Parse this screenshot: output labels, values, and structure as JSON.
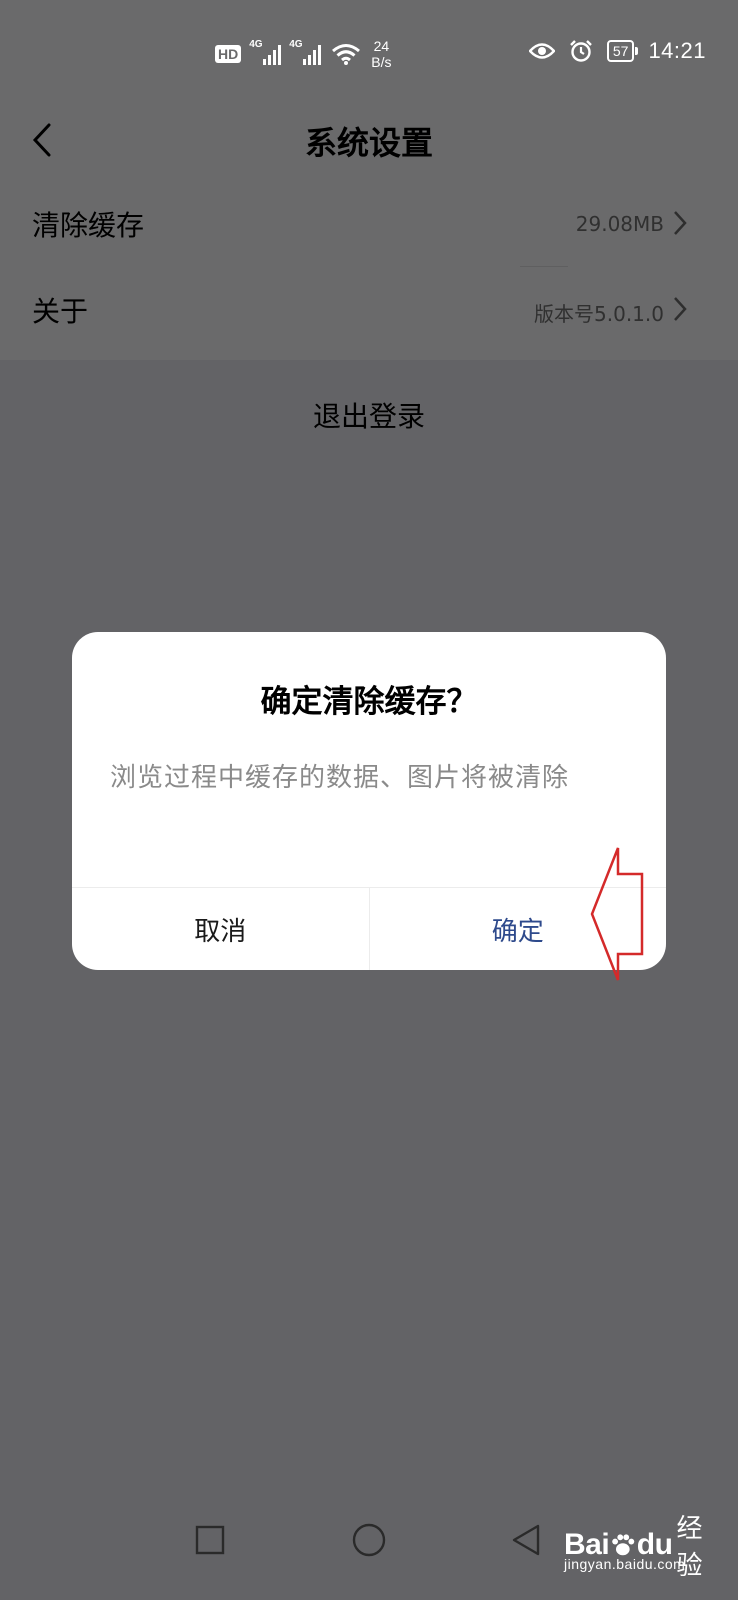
{
  "status_bar": {
    "hd_label": "HD",
    "network_1": "4G",
    "network_2": "4G",
    "net_speed_value": "24",
    "net_speed_unit": "B/s",
    "battery": "57",
    "time": "14:21"
  },
  "header": {
    "title": "系统设置"
  },
  "settings": {
    "items": [
      {
        "label": "清除缓存",
        "value": "29.08MB"
      },
      {
        "label": "关于",
        "value": "版本号5.0.1.0"
      }
    ],
    "logout_label": "退出登录"
  },
  "dialog": {
    "title": "确定清除缓存？",
    "message": "浏览过程中缓存的数据、图片将被清除",
    "cancel_label": "取消",
    "confirm_label": "确定"
  },
  "watermark": {
    "logo_left": "Bai",
    "logo_right": "du",
    "logo_cn": "经验",
    "url": "jingyan.baidu.com"
  },
  "colors": {
    "overlay_bg": "#636366",
    "confirm_text": "#2e4a8c",
    "annotation": "#d42a2a"
  }
}
